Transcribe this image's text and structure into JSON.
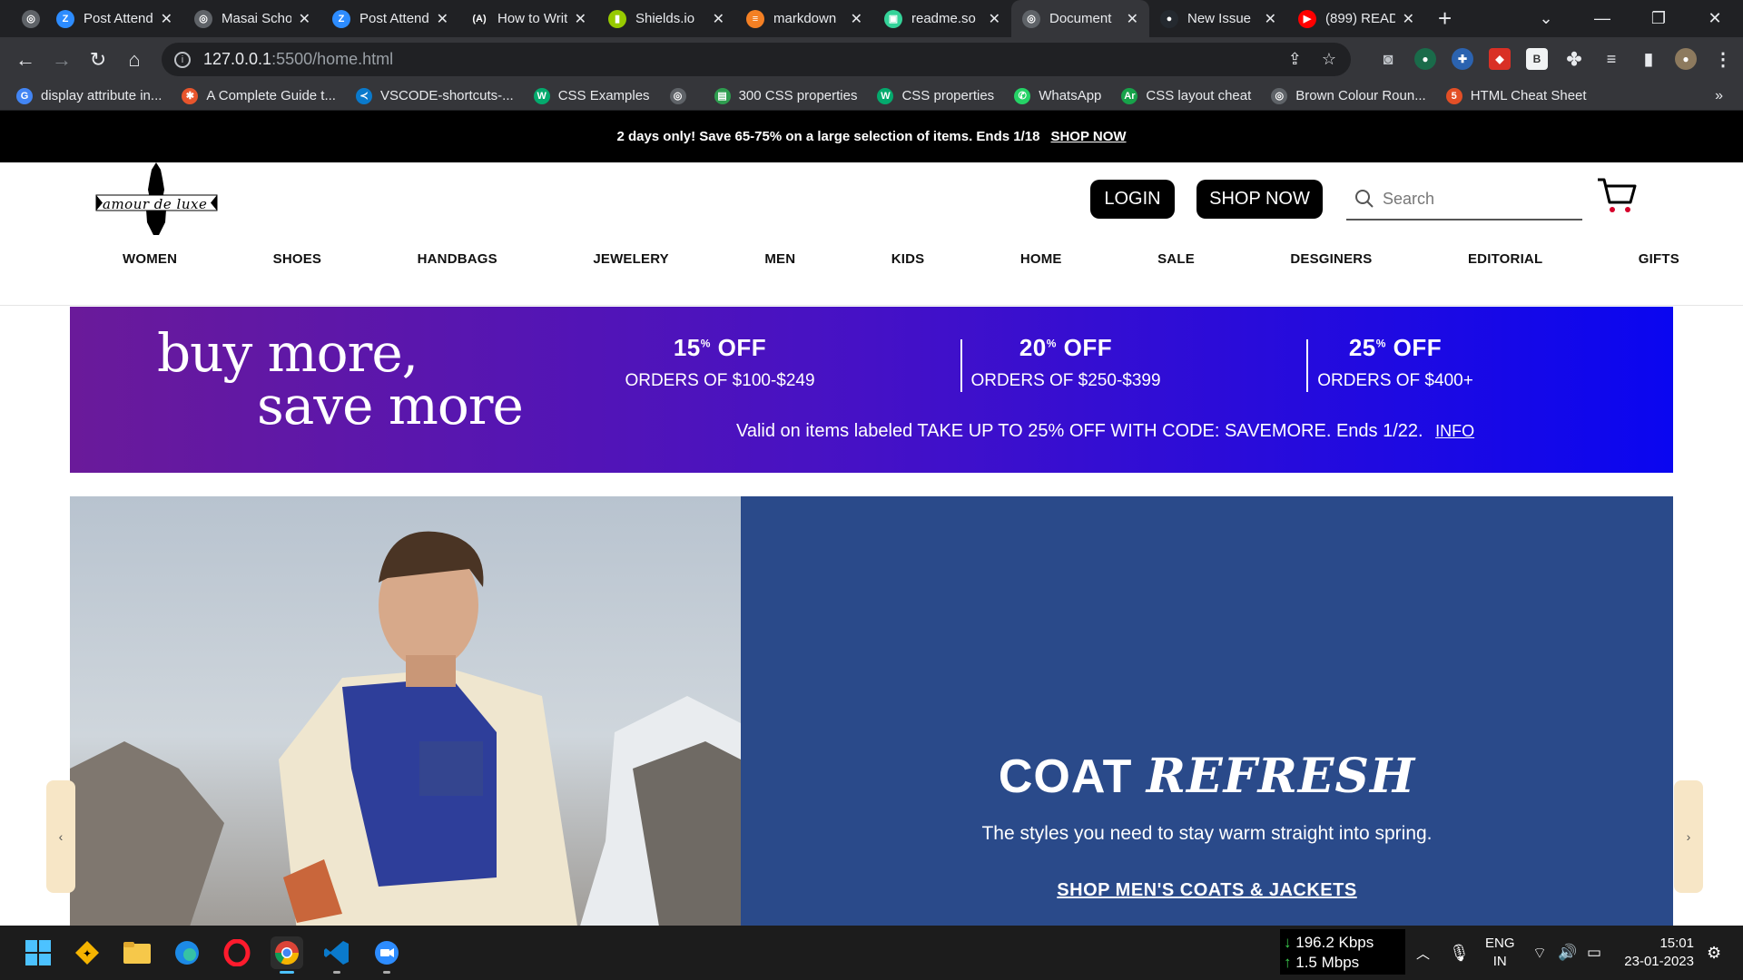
{
  "browser": {
    "tabs": [
      {
        "label": "Post Attendance",
        "icon": "zoom-icon",
        "color": "#2d8cff",
        "glyph": "Z",
        "active": false
      },
      {
        "label": "Masai School",
        "icon": "globe-icon",
        "color": "#5f6368",
        "glyph": "◎",
        "active": false
      },
      {
        "label": "Post Attendance",
        "icon": "zoom-icon",
        "color": "#2d8cff",
        "glyph": "Z",
        "active": false
      },
      {
        "label": "How to Write",
        "icon": "a-icon",
        "color": "#202124",
        "glyph": "(A)",
        "active": false
      },
      {
        "label": "Shields.io",
        "icon": "shields-icon",
        "color": "#97ca00",
        "glyph": "▮",
        "active": false
      },
      {
        "label": "markdown",
        "icon": "stackoverflow-icon",
        "color": "#f48024",
        "glyph": "≡",
        "active": false
      },
      {
        "label": "readme.so",
        "icon": "readme-icon",
        "color": "#34d399",
        "glyph": "▣",
        "active": false
      },
      {
        "label": "Document",
        "icon": "globe-icon",
        "color": "#5f6368",
        "glyph": "◎",
        "active": true
      },
      {
        "label": "New Issue",
        "icon": "github-icon",
        "color": "#24292f",
        "glyph": "●",
        "active": false
      },
      {
        "label": "(899) READ",
        "icon": "youtube-icon",
        "color": "#ff0000",
        "glyph": "▶",
        "active": false
      }
    ],
    "url_host": "127.0.0.1",
    "url_path": ":5500/home.html",
    "bookmarks": [
      {
        "label": "display attribute in...",
        "icon": "google-icon",
        "color": "#4285f4",
        "glyph": "G"
      },
      {
        "label": "A Complete Guide t...",
        "icon": "css-tricks-icon",
        "color": "#e8552c",
        "glyph": "✱"
      },
      {
        "label": "VSCODE-shortcuts-...",
        "icon": "vscode-icon",
        "color": "#0a7acc",
        "glyph": "≺"
      },
      {
        "label": "CSS Examples",
        "icon": "w3schools-icon",
        "color": "#04aa6d",
        "glyph": "W"
      },
      {
        "label": "",
        "icon": "globe-icon",
        "color": "#5f6368",
        "glyph": "◎"
      },
      {
        "label": "300 CSS properties",
        "icon": "css-props-icon",
        "color": "#2e9d4f",
        "glyph": "▤"
      },
      {
        "label": "CSS properties",
        "icon": "w3schools-icon",
        "color": "#04aa6d",
        "glyph": "W"
      },
      {
        "label": "WhatsApp",
        "icon": "whatsapp-icon",
        "color": "#25d366",
        "glyph": "✆"
      },
      {
        "label": "CSS layout cheat",
        "icon": "layout-icon",
        "color": "#17a34a",
        "glyph": "Ar"
      },
      {
        "label": "Brown Colour Roun...",
        "icon": "globe-icon",
        "color": "#5f6368",
        "glyph": "◎"
      },
      {
        "label": "HTML Cheat Sheet",
        "icon": "html-icon",
        "color": "#e34f26",
        "glyph": "5"
      }
    ]
  },
  "site": {
    "promo_text": "2 days only! Save 65-75% on a large selection of items. Ends 1/18",
    "promo_link": "SHOP NOW",
    "logo_text": "amour de luxe",
    "login_label": "LOGIN",
    "shop_label": "SHOP NOW",
    "search_placeholder": "Search",
    "nav": [
      "WOMEN",
      "SHOES",
      "HANDBAGS",
      "JEWELERY",
      "MEN",
      "KIDS",
      "HOME",
      "SALE",
      "DESGINERS",
      "EDITORIAL",
      "GIFTS"
    ],
    "banner": {
      "title_line1": "buy more,",
      "title_line2": "save more",
      "offers": [
        {
          "pct": "15",
          "off": "OFF",
          "range": "ORDERS OF $100-$249"
        },
        {
          "pct": "20",
          "off": "OFF",
          "range": "ORDERS OF $250-$399"
        },
        {
          "pct": "25",
          "off": "OFF",
          "range": "ORDERS OF $400+"
        }
      ],
      "valid_text": "Valid on items labeled TAKE UP TO 25% OFF WITH CODE: SAVEMORE. Ends 1/22.",
      "info_link": "INFO"
    },
    "hero": {
      "title_plain": "COAT",
      "title_italic": "REFRESH",
      "subtitle": "The styles you need to stay warm straight into spring.",
      "cta": "SHOP MEN'S COATS & JACKETS"
    },
    "carousel_prev": "‹",
    "carousel_next": "›"
  },
  "taskbar": {
    "net_down": "196.2 Kbps",
    "net_up": "1.5 Mbps",
    "lang_top": "ENG",
    "lang_bottom": "IN",
    "time": "15:01",
    "date": "23-01-2023"
  }
}
